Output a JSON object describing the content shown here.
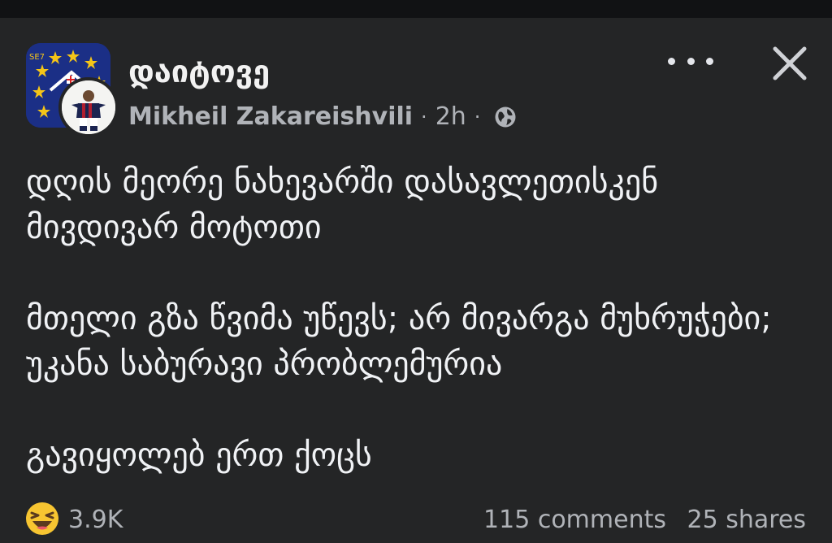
{
  "post": {
    "group_name": "დაიტოვე",
    "author": "Mikheil Zakareishvili",
    "separator": "·",
    "time": "2h",
    "privacy_icon": "globe-icon",
    "avatar_badge_text": "SE7",
    "paragraphs": [
      "დღის მეორე ნახევარში დასავლეთისკენ მივდივარ მოტოთი",
      "მთელი გზა წვიმა უწევს; არ მივარგა მუხრუჭები; უკანა საბურავი პრობლემურია",
      "გავიყოლებ ერთ ქოცს"
    ]
  },
  "footer": {
    "reaction_icon": "laughing-emoji-icon",
    "reaction_count": "3.9K",
    "comments": "115 comments",
    "shares": "25 shares"
  },
  "colors": {
    "background": "#242526",
    "text_primary": "#f0f2f5",
    "text_secondary": "#b0b3b8",
    "group_avatar_bg": "#1b2f86",
    "star_color": "#f5c518"
  }
}
